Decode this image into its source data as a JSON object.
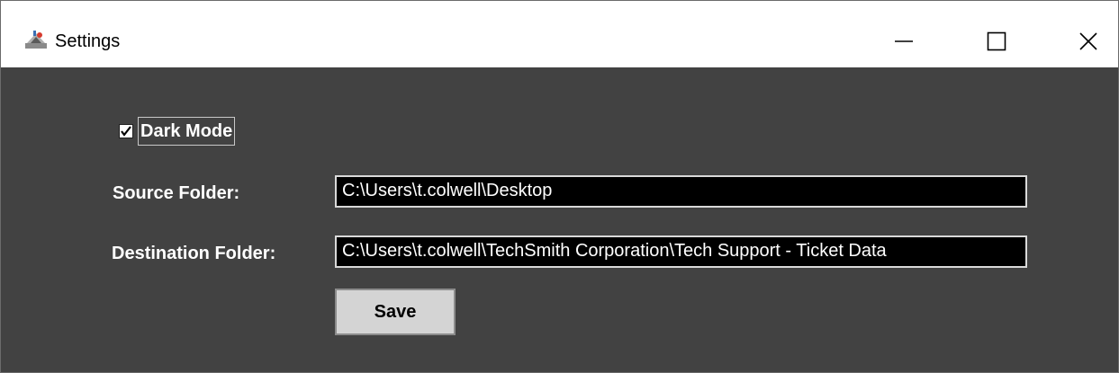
{
  "window": {
    "title": "Settings",
    "app_icon": "java-cup-icon",
    "controls": {
      "minimize_icon": "minimize-icon",
      "maximize_icon": "maximize-icon",
      "close_icon": "close-icon"
    }
  },
  "settings": {
    "dark_mode": {
      "label": "Dark Mode",
      "checked": true
    },
    "source_folder": {
      "label": "Source Folder:",
      "value": "C:\\Users\\t.colwell\\Desktop"
    },
    "destination_folder": {
      "label": "Destination Folder:",
      "value": "C:\\Users\\t.colwell\\TechSmith Corporation\\Tech Support - Ticket Data"
    },
    "save_label": "Save"
  },
  "colors": {
    "background": "#424242",
    "field_background": "#000000",
    "text": "#ffffff",
    "button": "#d4d4d4"
  }
}
